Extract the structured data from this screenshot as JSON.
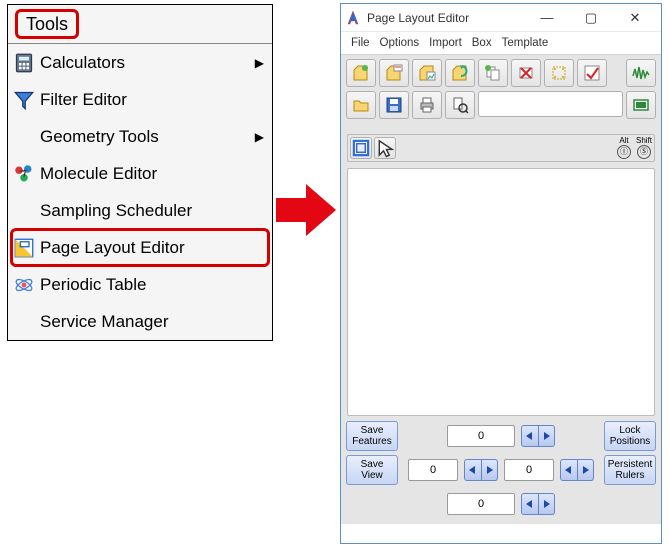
{
  "menu": {
    "header": "Tools",
    "items": [
      {
        "label": "Calculators",
        "icon": "calculator-icon",
        "submenu": true
      },
      {
        "label": "Filter Editor",
        "icon": "filter-icon",
        "submenu": false
      },
      {
        "label": "Geometry Tools",
        "icon": "",
        "submenu": true
      },
      {
        "label": "Molecule Editor",
        "icon": "molecule-icon",
        "submenu": false
      },
      {
        "label": "Sampling Scheduler",
        "icon": "",
        "submenu": false
      },
      {
        "label": "Page Layout Editor",
        "icon": "layout-icon",
        "submenu": false,
        "highlighted": true
      },
      {
        "label": "Periodic Table",
        "icon": "periodic-table-icon",
        "submenu": false
      },
      {
        "label": "Service Manager",
        "icon": "",
        "submenu": false
      }
    ]
  },
  "window": {
    "title": "Page Layout Editor",
    "menubar": [
      "File",
      "Options",
      "Import",
      "Box",
      "Template"
    ],
    "alt_label": "Alt",
    "shift_label": "Shift",
    "alt_code": "①",
    "shift_code": "Ⓢ",
    "bottom": {
      "save_features": "Save\nFeatures",
      "save_view": "Save\nView",
      "lock_positions": "Lock\nPositions",
      "persistent_rulers": "Persistent\nRulers",
      "n1": "0",
      "n2": "0",
      "n3": "0",
      "n4": "0"
    }
  }
}
